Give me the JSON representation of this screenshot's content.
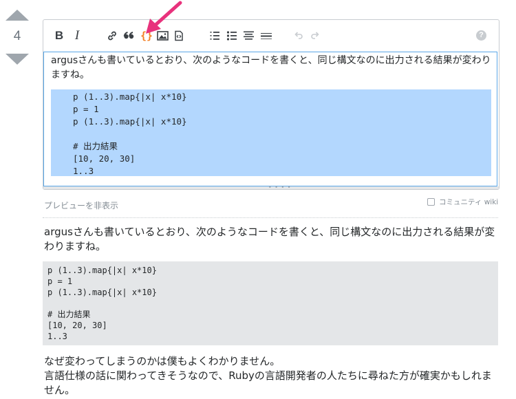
{
  "vote": {
    "count": "4"
  },
  "toolbar": {
    "bold_label": "B",
    "italic_label": "I",
    "code_label": "{}",
    "help_label": "?",
    "accent_color": "#f48024",
    "icons": [
      "link-icon",
      "quote-icon",
      "code-icon",
      "image-icon",
      "snippet-icon",
      "numbered-list-icon",
      "bullet-list-icon",
      "heading-icon",
      "horizontal-rule-icon",
      "undo-icon",
      "redo-icon",
      "help-icon"
    ]
  },
  "editor": {
    "text": "argusさんも書いているとおり、次のようなコードを書くと、同じ構文なのに出力される結果が変わりますね。",
    "code": "p (1..3).map{|x| x*10}\np = 1\np (1..3).map{|x| x*10}\n\n# 出力結果\n[10, 20, 30]\n1..3",
    "selection_color": "#b3d7fe"
  },
  "preview_toggle": "プレビューを非表示",
  "community_wiki_label": "コミュニティ wiki",
  "preview": {
    "paragraph1": "argusさんも書いているとおり、次のようなコードを書くと、同じ構文なのに出力される結果が変わりますね。",
    "code": "p (1..3).map{|x| x*10}\np = 1\np (1..3).map{|x| x*10}\n\n# 出力結果\n[10, 20, 30]\n1..3",
    "paragraph2_line1": "なぜ変わってしまうのかは僕もよくわかりません。",
    "paragraph2_line2": "言語仕様の話に関わってきそうなので、Rubyの言語開発者の人たちに尋ねた方が確実かもしれません。"
  },
  "annotation": {
    "arrow_color": "#e8327c"
  }
}
